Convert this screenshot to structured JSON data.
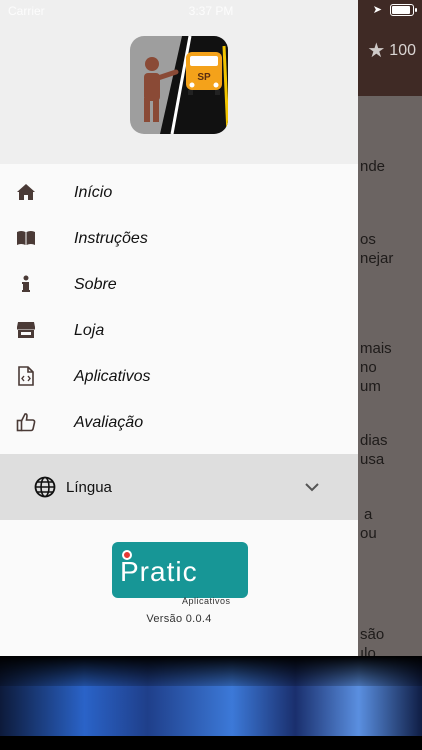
{
  "status_bar": {
    "carrier": "Carrier",
    "time": "3:37 PM"
  },
  "background": {
    "rating": "100",
    "fragments": [
      "nde",
      "os",
      "nejar",
      "mais",
      "no",
      "um",
      "dias",
      "usa",
      "a",
      "ou",
      "são",
      "ılo"
    ]
  },
  "drawer": {
    "menu_items": [
      {
        "label": "Início",
        "icon": "home-icon"
      },
      {
        "label": "Instruções",
        "icon": "book-icon"
      },
      {
        "label": "Sobre",
        "icon": "info-icon"
      },
      {
        "label": "Loja",
        "icon": "store-icon"
      },
      {
        "label": "Aplicativos",
        "icon": "code-file-icon"
      },
      {
        "label": "Avaliação",
        "icon": "thumbs-up-icon"
      }
    ],
    "language": {
      "label": "Língua"
    },
    "footer": {
      "brand": "Pratic",
      "brand_sub": "Aplicativos",
      "version": "Versão 0.0.4"
    },
    "logo_text": "SP"
  },
  "colors": {
    "accent": "#179696",
    "topbar": "#3f2a25",
    "icon": "#4a3a36"
  }
}
